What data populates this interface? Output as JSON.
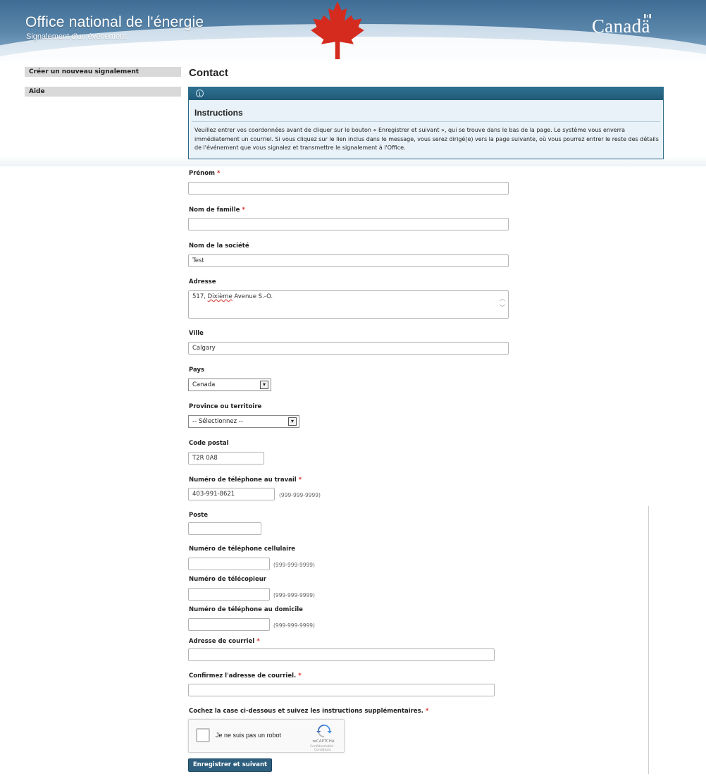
{
  "header": {
    "site_title": "Office national de l'énergie",
    "site_subtitle": "Signalement d'un événement",
    "wordmark": "Canadä",
    "brand_colors": {
      "banner_dark": "#3d6c94",
      "leaf_red": "#d52b1e"
    }
  },
  "nav": {
    "items": [
      {
        "label": "Créer un nouveau signalement"
      },
      {
        "label": "Aide"
      }
    ]
  },
  "page": {
    "heading": "Contact"
  },
  "instructions": {
    "icon": "info-icon",
    "title": "Instructions",
    "text": "Veuillez entrer vos coordonnées avant de cliquer sur le bouton « Enregistrer et suivant », qui se trouve dans le bas de la page. Le système vous enverra immédiatement un courriel. Si vous cliquez sur le lien inclus dans le message, vous serez dirigé(e) vers la page suivante, où vous pourrez entrer le reste des détails de l'événement que vous signalez et transmettre le signalement à l'Office."
  },
  "form": {
    "required_mark": "*",
    "first_name": {
      "label": "Prénom",
      "value": ""
    },
    "last_name": {
      "label": "Nom de famille",
      "value": ""
    },
    "company": {
      "label": "Nom de la société",
      "value": "Test"
    },
    "address": {
      "label": "Adresse",
      "value_prefix": "517, ",
      "value_flagged": "Dixième",
      "value_suffix": " Avenue S.-O."
    },
    "city": {
      "label": "Ville",
      "value": "Calgary"
    },
    "country": {
      "label": "Pays",
      "selected": "Canada"
    },
    "province": {
      "label": "Province ou territoire",
      "selected": "-- Sélectionnez --"
    },
    "postal_code": {
      "label": "Code postal",
      "value": "T2R 0A8"
    },
    "work_phone": {
      "label": "Numéro de téléphone au travail",
      "value": "403-991-8621",
      "hint": "(999-999-9999)"
    },
    "extension": {
      "label": "Poste",
      "value": ""
    },
    "cell_phone": {
      "label": "Numéro de téléphone cellulaire",
      "value": "",
      "hint": "(999-999-9999)"
    },
    "fax": {
      "label": "Numéro de télécopieur",
      "value": "",
      "hint": "(999-999-9999)"
    },
    "home_phone": {
      "label": "Numéro de téléphone au domicile",
      "value": "",
      "hint": "(999-999-9999)"
    },
    "email": {
      "label": "Adresse de courriel",
      "value": ""
    },
    "email_confirm": {
      "label": "Confirmez l'adresse de courriel.",
      "value": ""
    },
    "captcha": {
      "label": "Cochez la case ci-dessous et suivez les instructions supplémentaires.",
      "checkbox_text": "Je ne suis pas un robot",
      "brand": "reCAPTCHA",
      "links": "Confidentialité - Conditions"
    },
    "submit_label": "Enregistrer et suivant"
  }
}
